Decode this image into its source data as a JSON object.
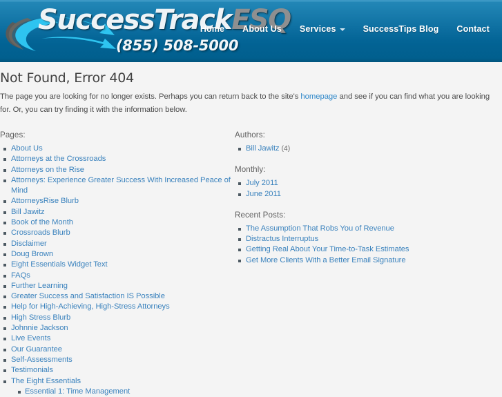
{
  "header": {
    "logo": {
      "brand_part1": "SuccessTrack",
      "brand_part2": "ESQ",
      "phone": "(855) 508-5000",
      "swoosh_cyan": "#29c3ef",
      "swoosh_shadow": "#5d5b57"
    },
    "bg_color": "#06699c",
    "nav": [
      {
        "label": "Home",
        "has_caret": false
      },
      {
        "label": "About Us",
        "has_caret": false
      },
      {
        "label": "Services",
        "has_caret": true
      },
      {
        "label": "SuccessTips Blog",
        "has_caret": false
      },
      {
        "label": "Contact",
        "has_caret": false
      }
    ]
  },
  "main": {
    "title": "Not Found, Error 404",
    "intro_before": "The page you are looking for no longer exists. Perhaps you can return back to the site's ",
    "intro_link": "homepage",
    "intro_after": " and see if you can find what you are looking for. Or, you can try finding it with the information below.",
    "link_color": "#3a82bd"
  },
  "pages": {
    "label": "Pages:",
    "items": [
      "About Us",
      "Attorneys at the Crossroads",
      "Attorneys on the Rise",
      "Attorneys: Experience Greater Success With Increased Peace of Mind",
      "AttorneysRise Blurb",
      "Bill Jawitz",
      "Book of the Month",
      "Crossroads Blurb",
      "Disclaimer",
      "Doug Brown",
      "Eight Essentials Widget Text",
      "FAQs",
      "Further Learning",
      "Greater Success and Satisfaction IS Possible",
      "Help for High-Achieving, High-Stress Attorneys",
      "High Stress Blurb",
      "Johnnie Jackson",
      "Live Events",
      "Our Guarantee",
      "Self-Assessments",
      "Testimonials",
      "The Eight Essentials"
    ],
    "sub_items": [
      "Essential 1: Time Management"
    ]
  },
  "authors": {
    "label": "Authors:",
    "items": [
      {
        "name": "Bill Jawitz",
        "count": "(4)"
      }
    ]
  },
  "monthly": {
    "label": "Monthly:",
    "items": [
      "July 2011",
      "June 2011"
    ]
  },
  "recent_posts": {
    "label": "Recent Posts:",
    "items": [
      "The Assumption That Robs You of Revenue",
      "Distractus Interruptus",
      "Getting Real About Your Time-to-Task Estimates",
      "Get More Clients With a Better Email Signature"
    ]
  }
}
